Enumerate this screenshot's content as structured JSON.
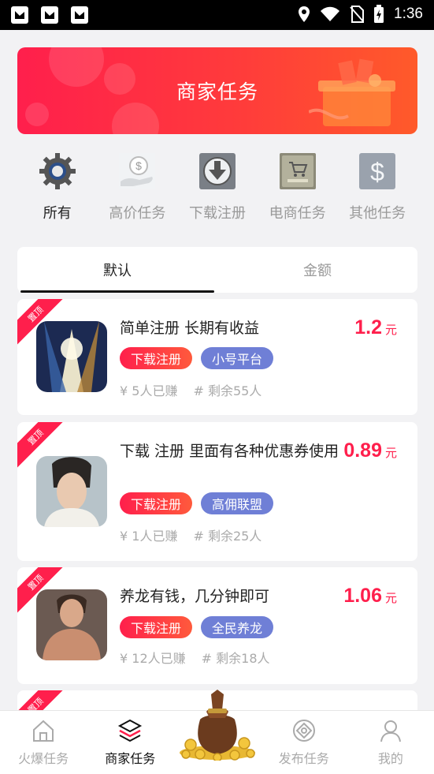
{
  "status_bar": {
    "time": "1:36"
  },
  "banner": {
    "title": "商家任务"
  },
  "categories": [
    {
      "label": "所有",
      "icon": "gear-icon",
      "active": true
    },
    {
      "label": "高价任务",
      "icon": "money-hand-icon",
      "active": false
    },
    {
      "label": "下载注册",
      "icon": "download-icon",
      "active": false
    },
    {
      "label": "电商任务",
      "icon": "cart-icon",
      "active": false
    },
    {
      "label": "其他任务",
      "icon": "dollar-icon",
      "active": false
    }
  ],
  "sort_tabs": [
    {
      "label": "默认",
      "active": true
    },
    {
      "label": "金额",
      "active": false
    }
  ],
  "tasks": [
    {
      "ribbon": "置顶",
      "title": "简单注册 长期有收益",
      "price": "1.2",
      "unit": "元",
      "tags": [
        "下载注册",
        "小号平台"
      ],
      "earned": "¥ 5人已赚",
      "remaining": "# 剩余55人"
    },
    {
      "ribbon": "置顶",
      "title": "下载 注册 里面有各种优惠券使用",
      "price": "0.89",
      "unit": "元",
      "tags": [
        "下载注册",
        "高佣联盟"
      ],
      "earned": "¥ 1人已赚",
      "remaining": "# 剩余25人"
    },
    {
      "ribbon": "置顶",
      "title": "养龙有钱，几分钟即可",
      "price": "1.06",
      "unit": "元",
      "tags": [
        "下载注册",
        "全民养龙"
      ],
      "earned": "¥ 12人已赚",
      "remaining": "# 剩余18人"
    },
    {
      "ribbon": "置顶"
    }
  ],
  "bottom_nav": [
    {
      "label": "火爆任务",
      "icon": "home-icon",
      "active": false
    },
    {
      "label": "商家任务",
      "icon": "layers-icon",
      "active": true
    },
    {
      "label": "",
      "icon": "money-bag-icon",
      "active": false
    },
    {
      "label": "发布任务",
      "icon": "publish-icon",
      "active": false
    },
    {
      "label": "我的",
      "icon": "user-icon",
      "active": false
    }
  ],
  "colors": {
    "accent": "#ff1f4c",
    "tag_blue": "#6f7fd6"
  }
}
